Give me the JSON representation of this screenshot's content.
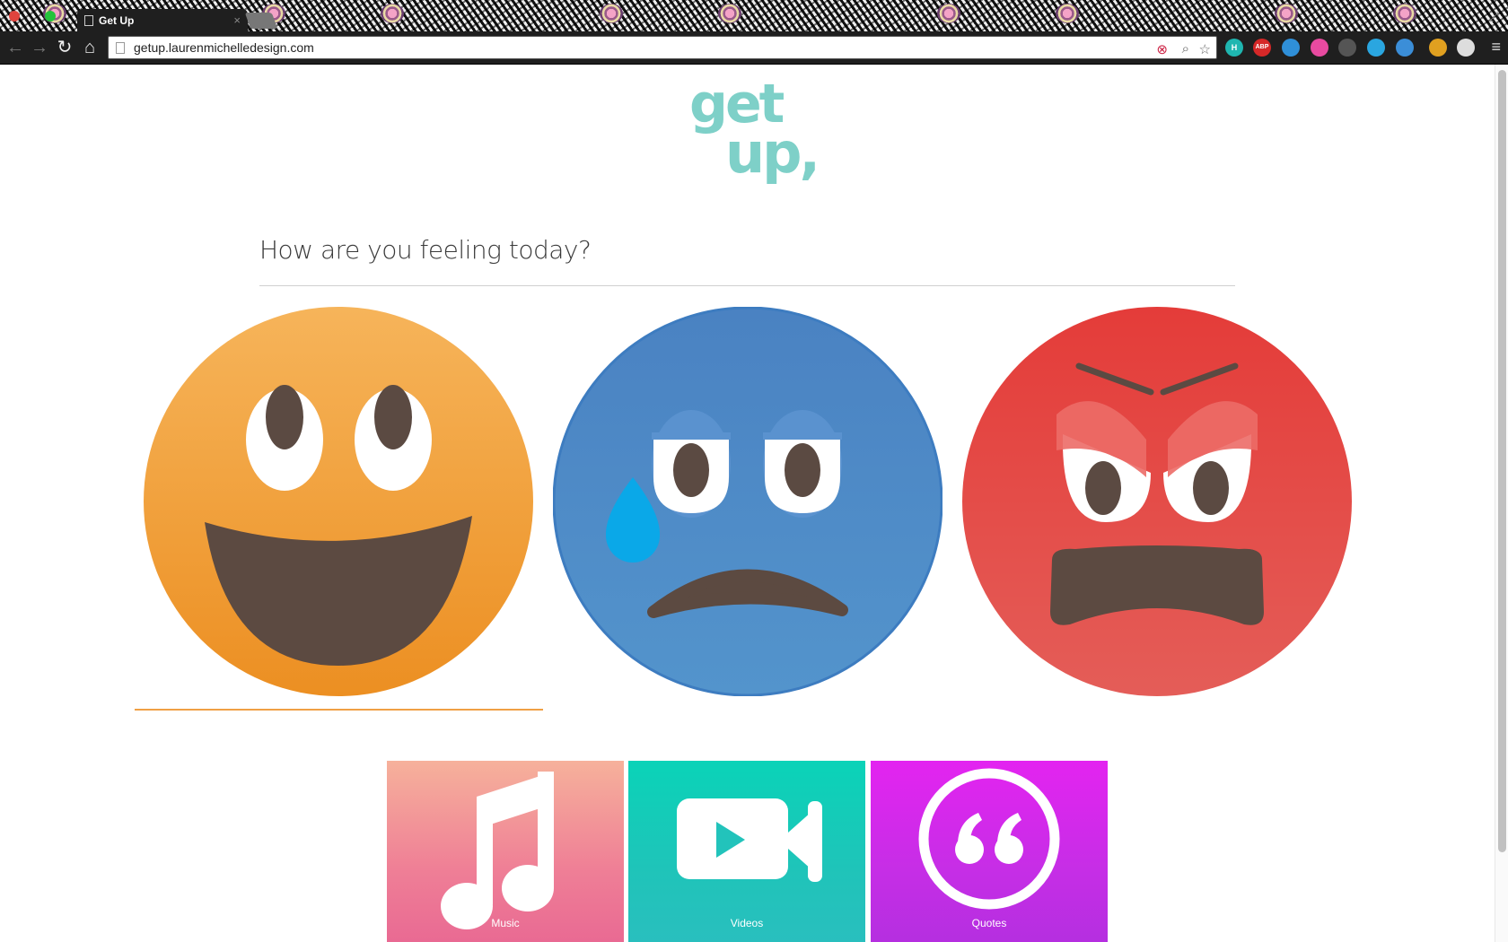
{
  "browser": {
    "tab_title": "Get Up",
    "tab_close": "×",
    "url": "getup.laurenmichelledesign.com",
    "extensions": [
      {
        "name": "h-extension-icon",
        "glyph": "H",
        "color": "#1fb6b0"
      },
      {
        "name": "adblock-plus-icon",
        "glyph": "ABP",
        "color": "#d62828"
      },
      {
        "name": "globe-extension-icon",
        "glyph": "",
        "color": "#2f8fd8"
      },
      {
        "name": "color-wheel-extension-icon",
        "glyph": "",
        "color": "#e84aa0"
      },
      {
        "name": "cast-icon",
        "glyph": "",
        "color": "#555555"
      },
      {
        "name": "circle-extension-icon",
        "glyph": "",
        "color": "#2aa6e0"
      },
      {
        "name": "bookmark-extension-icon",
        "glyph": "",
        "color": "#3b8ed8"
      },
      {
        "name": "evernote-extension-icon",
        "glyph": "",
        "color": "#e0a020"
      },
      {
        "name": "profile-extension-icon",
        "glyph": "",
        "color": "#dddddd"
      }
    ]
  },
  "page": {
    "logo_line1": "get",
    "logo_line2": "up,",
    "question": "How are you feeling today?",
    "moods": [
      {
        "name": "happy",
        "color": "#f0962c",
        "selected": true
      },
      {
        "name": "sad",
        "color": "#4f8cc7",
        "selected": false
      },
      {
        "name": "angry",
        "color": "#e44a47",
        "selected": false
      }
    ],
    "categories": [
      {
        "label": "Music",
        "icon": "music-note-icon"
      },
      {
        "label": "Videos",
        "icon": "video-camera-icon"
      },
      {
        "label": "Quotes",
        "icon": "quote-icon"
      }
    ]
  }
}
